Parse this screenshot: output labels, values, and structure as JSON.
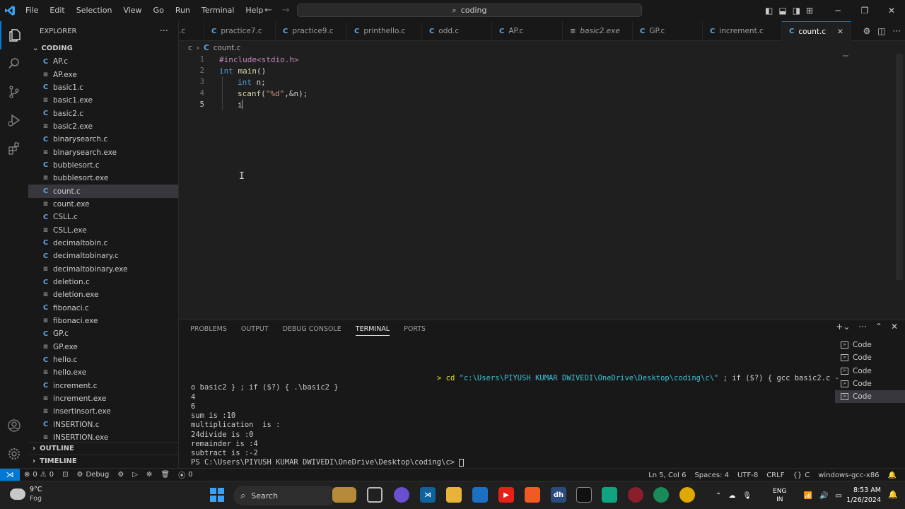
{
  "menu": [
    "File",
    "Edit",
    "Selection",
    "View",
    "Go",
    "Run",
    "Terminal",
    "Help"
  ],
  "command_center": "coding",
  "explorer": {
    "title": "EXPLORER",
    "folder": "CODING",
    "files": [
      {
        "name": "AP.c",
        "type": "c"
      },
      {
        "name": "AP.exe",
        "type": "exe"
      },
      {
        "name": "basic1.c",
        "type": "c"
      },
      {
        "name": "basic1.exe",
        "type": "exe"
      },
      {
        "name": "basic2.c",
        "type": "c"
      },
      {
        "name": "basic2.exe",
        "type": "exe"
      },
      {
        "name": "binarysearch.c",
        "type": "c"
      },
      {
        "name": "binarysearch.exe",
        "type": "exe"
      },
      {
        "name": "bubblesort.c",
        "type": "c"
      },
      {
        "name": "bubblesort.exe",
        "type": "exe"
      },
      {
        "name": "count.c",
        "type": "c",
        "active": true
      },
      {
        "name": "count.exe",
        "type": "exe"
      },
      {
        "name": "CSLL.c",
        "type": "c"
      },
      {
        "name": "CSLL.exe",
        "type": "exe"
      },
      {
        "name": "decimaltobin.c",
        "type": "c"
      },
      {
        "name": "decimaltobinary.c",
        "type": "c"
      },
      {
        "name": "decimaltobinary.exe",
        "type": "exe"
      },
      {
        "name": "deletion.c",
        "type": "c"
      },
      {
        "name": "deletion.exe",
        "type": "exe"
      },
      {
        "name": "fibonaci.c",
        "type": "c"
      },
      {
        "name": "fibonaci.exe",
        "type": "exe"
      },
      {
        "name": "GP.c",
        "type": "c"
      },
      {
        "name": "GP.exe",
        "type": "exe"
      },
      {
        "name": "hello.c",
        "type": "c"
      },
      {
        "name": "hello.exe",
        "type": "exe"
      },
      {
        "name": "increment.c",
        "type": "c"
      },
      {
        "name": "increment.exe",
        "type": "exe"
      },
      {
        "name": "insertinsort.exe",
        "type": "exe"
      },
      {
        "name": "INSERTION.c",
        "type": "c"
      },
      {
        "name": "INSERTION.exe",
        "type": "exe"
      }
    ],
    "outline": "OUTLINE",
    "timeline": "TIMELINE"
  },
  "tabs": [
    {
      "label": ".c",
      "icon": "",
      "x": 0
    },
    {
      "label": "practice7.c",
      "icon": "C"
    },
    {
      "label": "practice9.c",
      "icon": "C"
    },
    {
      "label": "printhello.c",
      "icon": "C"
    },
    {
      "label": "odd.c",
      "icon": "C"
    },
    {
      "label": "AP.c",
      "icon": "C"
    },
    {
      "label": "basic2.exe",
      "icon": "≡",
      "italic": true
    },
    {
      "label": "GP.c",
      "icon": "C"
    },
    {
      "label": "increment.c",
      "icon": "C"
    },
    {
      "label": "count.c",
      "icon": "C",
      "active": true
    }
  ],
  "breadcrumb": {
    "folder": "c",
    "file": "count.c"
  },
  "editor": {
    "line_numbers": [
      "1",
      "2",
      "3",
      "4",
      "5"
    ],
    "line1": {
      "pp": "#include<stdio.h>"
    },
    "line2": {
      "kw": "int",
      "fn": "main",
      "rest": "()"
    },
    "line3": {
      "kw": "int",
      "rest": " n;"
    },
    "line4": {
      "fn": "scanf",
      "p1": "(",
      "str": "\"%d\"",
      "rest": ",&n);"
    },
    "line5": {
      "text": "i"
    }
  },
  "panel": {
    "tabs": [
      "PROBLEMS",
      "OUTPUT",
      "DEBUG CONSOLE",
      "TERMINAL",
      "PORTS"
    ],
    "active_tab": "TERMINAL",
    "terminal": {
      "cmd_prefix": "> cd ",
      "cmd_path": "\"c:\\Users\\PIYUSH KUMAR DWIVEDI\\OneDrive\\Desktop\\coding\\c\\\"",
      "cmd_rest": " ; if ($?) { gcc basic2.c -",
      "cont": "o basic2 } ; if ($?) { .\\basic2 }",
      "out1": "4",
      "out2": "6",
      "out3": "sum is :10",
      "out4": "multiplication  is :",
      "out5": "24divide is :0",
      "out6": "remainder is :4",
      "out7": "subtract is :-2",
      "prompt": "PS C:\\Users\\PIYUSH KUMAR DWIVEDI\\OneDrive\\Desktop\\coding\\c> "
    },
    "terminal_list": [
      "Code",
      "Code",
      "Code",
      "Code",
      "Code"
    ]
  },
  "statusbar": {
    "errors": "0",
    "warnings": "0",
    "debug": "Debug",
    "ports": "0",
    "position": "Ln 5, Col 6",
    "spaces": "Spaces: 4",
    "encoding": "UTF-8",
    "eol": "CRLF",
    "language": "C",
    "config": "windows-gcc-x86"
  },
  "taskbar": {
    "temp": "9°C",
    "weather": "Fog",
    "search": "Search",
    "lang_top": "ENG",
    "lang_bottom": "IN",
    "time": "8:53 AM",
    "date": "1/26/2024"
  },
  "colors": {
    "accent": "#0078d4",
    "c_icon": "#5fa4e0"
  }
}
